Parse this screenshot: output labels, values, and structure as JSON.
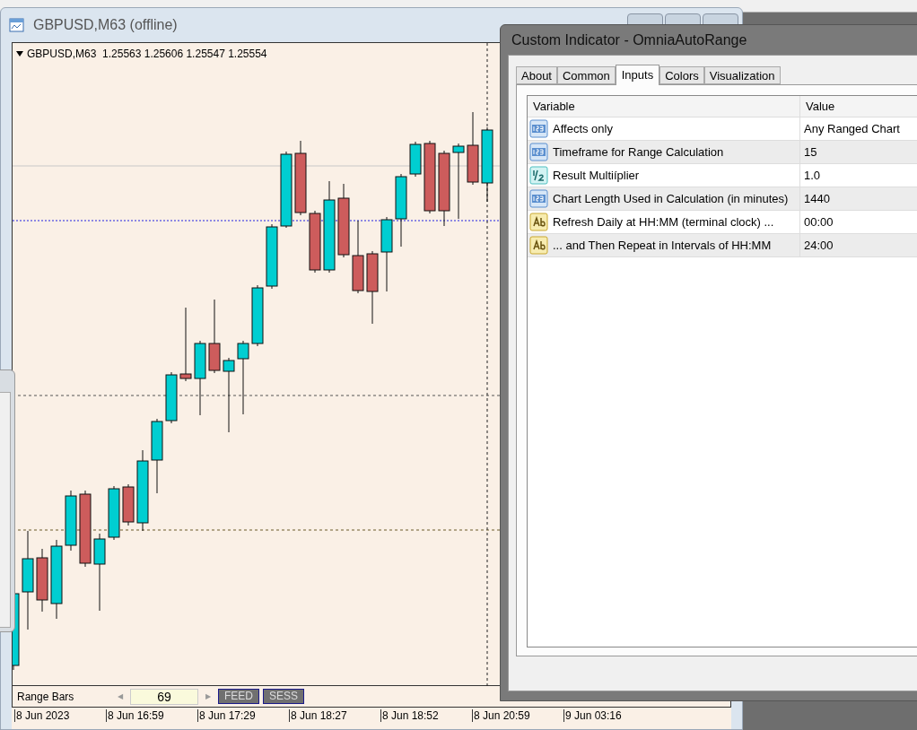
{
  "chart_window": {
    "title": "GBPUSD,M63 (offline)",
    "quote_line": "GBPUSD,M63  1.25563 1.25606 1.25547 1.25554"
  },
  "range_panel": {
    "label": "Range Bars",
    "left_arrow": "◀",
    "value": "69",
    "right_arrow": "▶",
    "buttons": [
      "FEED",
      "SESS"
    ]
  },
  "time_axis": [
    "8 Jun 2023",
    "8 Jun 16:59",
    "8 Jun 17:29",
    "8 Jun 18:27",
    "8 Jun 18:52",
    "8 Jun 20:59",
    "9 Jun 03:16"
  ],
  "dialog": {
    "title": "Custom Indicator - OmniaAutoRange",
    "tabs": [
      {
        "label": "About",
        "selected": false
      },
      {
        "label": "Common",
        "selected": false
      },
      {
        "label": "Inputs",
        "selected": true
      },
      {
        "label": "Colors",
        "selected": false
      },
      {
        "label": "Visualization",
        "selected": false
      }
    ],
    "columns": [
      "Variable",
      "Value"
    ],
    "rows": [
      {
        "kind": "integer",
        "variable": "Affects only",
        "value": "Any Ranged Chart"
      },
      {
        "kind": "integer",
        "variable": "Timeframe for Range Calculation",
        "value": "15"
      },
      {
        "kind": "double",
        "variable": "Result Multiíplier",
        "value": "1.0"
      },
      {
        "kind": "integer",
        "variable": "Chart Length Used in Calculation (in minutes)",
        "value": "1440"
      },
      {
        "kind": "string",
        "variable": "Refresh Daily at HH:MM (terminal clock) ...",
        "value": "00:00"
      },
      {
        "kind": "string",
        "variable": "... and Then Repeat in Intervals of HH:MM",
        "value": "24:00"
      }
    ]
  }
}
